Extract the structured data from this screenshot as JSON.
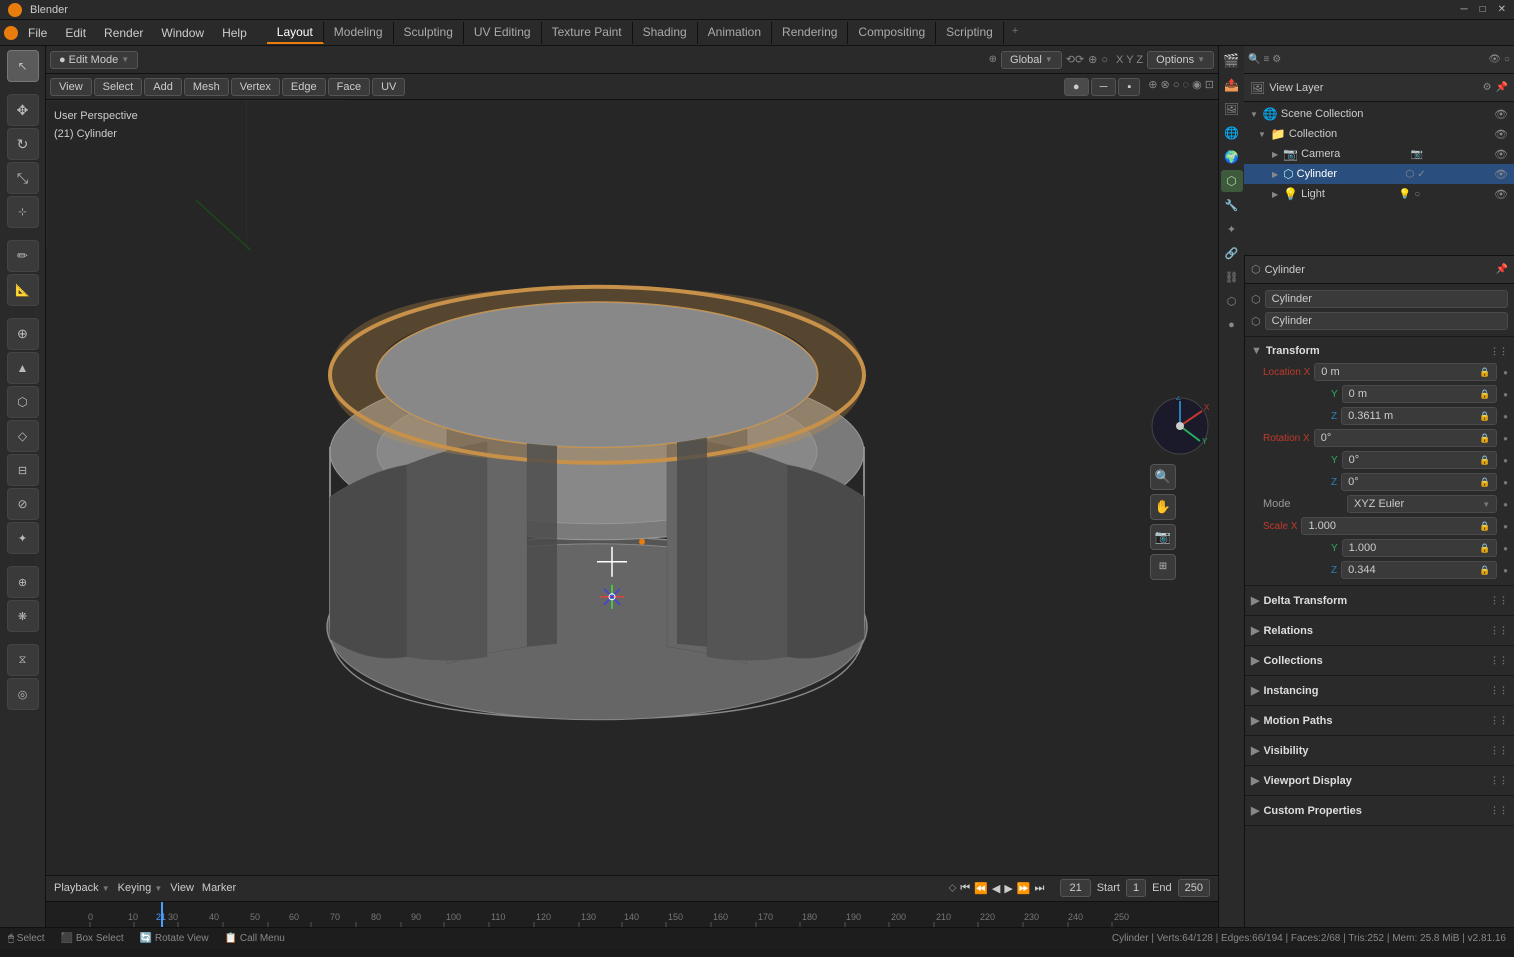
{
  "app": {
    "title": "Blender",
    "version": "2.81.16"
  },
  "title_bar": {
    "title": "Blender",
    "minimize": "─",
    "maximize": "□",
    "close": "✕"
  },
  "menu": {
    "items": [
      "File",
      "Edit",
      "Render",
      "Window",
      "Help"
    ]
  },
  "workspace_tabs": {
    "tabs": [
      "Layout",
      "Modeling",
      "Sculpting",
      "UV Editing",
      "Texture Paint",
      "Shading",
      "Animation",
      "Rendering",
      "Compositing",
      "Scripting"
    ],
    "active": "Layout",
    "plus": "+"
  },
  "viewport_header": {
    "mode": "Edit Mode",
    "transform_global": "Global",
    "options_label": "Options"
  },
  "viewport_info": {
    "view": "User Perspective",
    "object": "(21) Cylinder"
  },
  "edit_mode_header": {
    "items": [
      "View",
      "Select",
      "Add",
      "Mesh",
      "Vertex",
      "Edge",
      "Face",
      "UV"
    ]
  },
  "outliner": {
    "title": "Scene Collection",
    "items": [
      {
        "label": "Collection",
        "indent": 1,
        "icon": "📁",
        "expanded": true
      },
      {
        "label": "Camera",
        "indent": 2,
        "icon": "📷",
        "eye": "👁"
      },
      {
        "label": "Cylinder",
        "indent": 2,
        "icon": "⬡",
        "eye": "👁",
        "selected": true
      },
      {
        "label": "Light",
        "indent": 2,
        "icon": "💡",
        "eye": "👁"
      }
    ]
  },
  "view_layer": {
    "label": "View Layer"
  },
  "properties": {
    "object_name": "Cylinder",
    "data_name": "Cylinder",
    "transform_section": {
      "label": "Transform",
      "location": {
        "x": "0 m",
        "y": "0 m",
        "z": "0.3611 m"
      },
      "rotation": {
        "x": "0°",
        "y": "0°",
        "z": "0°",
        "mode": "XYZ Euler"
      },
      "scale": {
        "x": "1.000",
        "y": "1.000",
        "z": "0.344"
      }
    },
    "sections": [
      {
        "label": "Delta Transform",
        "expanded": false
      },
      {
        "label": "Relations",
        "expanded": false
      },
      {
        "label": "Collections",
        "expanded": false
      },
      {
        "label": "Instancing",
        "expanded": false
      },
      {
        "label": "Motion Paths",
        "expanded": false
      },
      {
        "label": "Visibility",
        "expanded": false
      },
      {
        "label": "Viewport Display",
        "expanded": false
      },
      {
        "label": "Custom Properties",
        "expanded": false
      }
    ]
  },
  "props_icons": {
    "icons": [
      "🎬",
      "🔧",
      "📐",
      "⚙",
      "🔩",
      "📊",
      "🎨",
      "🔗",
      "🌟"
    ]
  },
  "timeline": {
    "frame_current": 21,
    "start": 1,
    "end": 250,
    "marks": [
      "0",
      "10",
      "21",
      "30",
      "40",
      "50",
      "60",
      "70",
      "80",
      "90",
      "100",
      "110",
      "120",
      "130",
      "140",
      "150",
      "160",
      "170",
      "180",
      "190",
      "200",
      "210",
      "220",
      "230",
      "240",
      "250"
    ]
  },
  "status_bar": {
    "left": [
      {
        "key": "Select",
        "icon": "🖱",
        "shortcut": "Select"
      },
      {
        "key": "Box Select",
        "icon": "⬛",
        "shortcut": "Box Select"
      },
      {
        "key": "Rotate View",
        "icon": "🔄",
        "shortcut": "Rotate View"
      },
      {
        "key": "Call Menu",
        "icon": "📋",
        "shortcut": "Call Menu"
      }
    ],
    "right": "Cylinder | Verts:64/128 | Edges:66/194 | Faces:2/68 | Tris:252 | Mem: 25.8 MiB | v2.81.16"
  }
}
